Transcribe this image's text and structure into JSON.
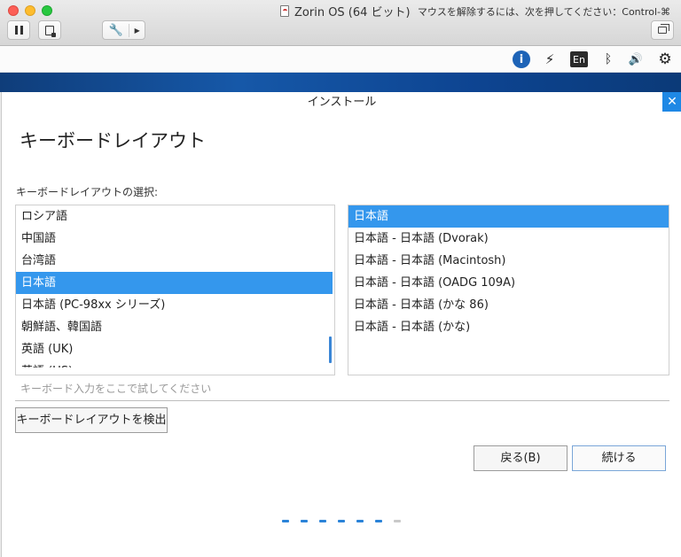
{
  "vm_window": {
    "title": "Zorin OS (64 ビット)",
    "release_hint": "マウスを解除するには、次を押してください：Control-⌘"
  },
  "vm_toolbar": {
    "wrench_glyph": "🔧",
    "arrow_glyph": "▶"
  },
  "guest_panel": {
    "accessibility_glyph": "i",
    "network_glyph": "⚡",
    "keyboard_language": "En",
    "bluetooth_glyph": "ᛒ",
    "volume_glyph": "🔊",
    "settings_glyph": "⚙"
  },
  "installer": {
    "window_title": "インストール",
    "close_glyph": "✕",
    "page_title": "キーボードレイアウト",
    "select_label": "キーボードレイアウトの選択:",
    "layouts": [
      "ロシア語",
      "中国語",
      "台湾語",
      "日本語",
      "日本語 (PC-98xx シリーズ)",
      "朝鮮語、韓国語",
      "英語 (UK)",
      "英語 (US)"
    ],
    "selected_layout": "日本語",
    "variants": [
      "日本語",
      "日本語 - 日本語 (Dvorak)",
      "日本語 - 日本語 (Macintosh)",
      "日本語 - 日本語 (OADG 109A)",
      "日本語 - 日本語 (かな 86)",
      "日本語 - 日本語 (かな)"
    ],
    "selected_variant": "日本語",
    "test_input_placeholder": "キーボード入力をここで試してください",
    "test_input_value": "",
    "detect_button": "キーボードレイアウトを検出",
    "back_button": "戻る(B)",
    "continue_button": "続ける",
    "progress": {
      "completed_steps": 6,
      "total_steps": 7
    }
  },
  "colors": {
    "selection": "#3497ed",
    "accent": "#1e88e5",
    "progress": "#2b83d8"
  }
}
